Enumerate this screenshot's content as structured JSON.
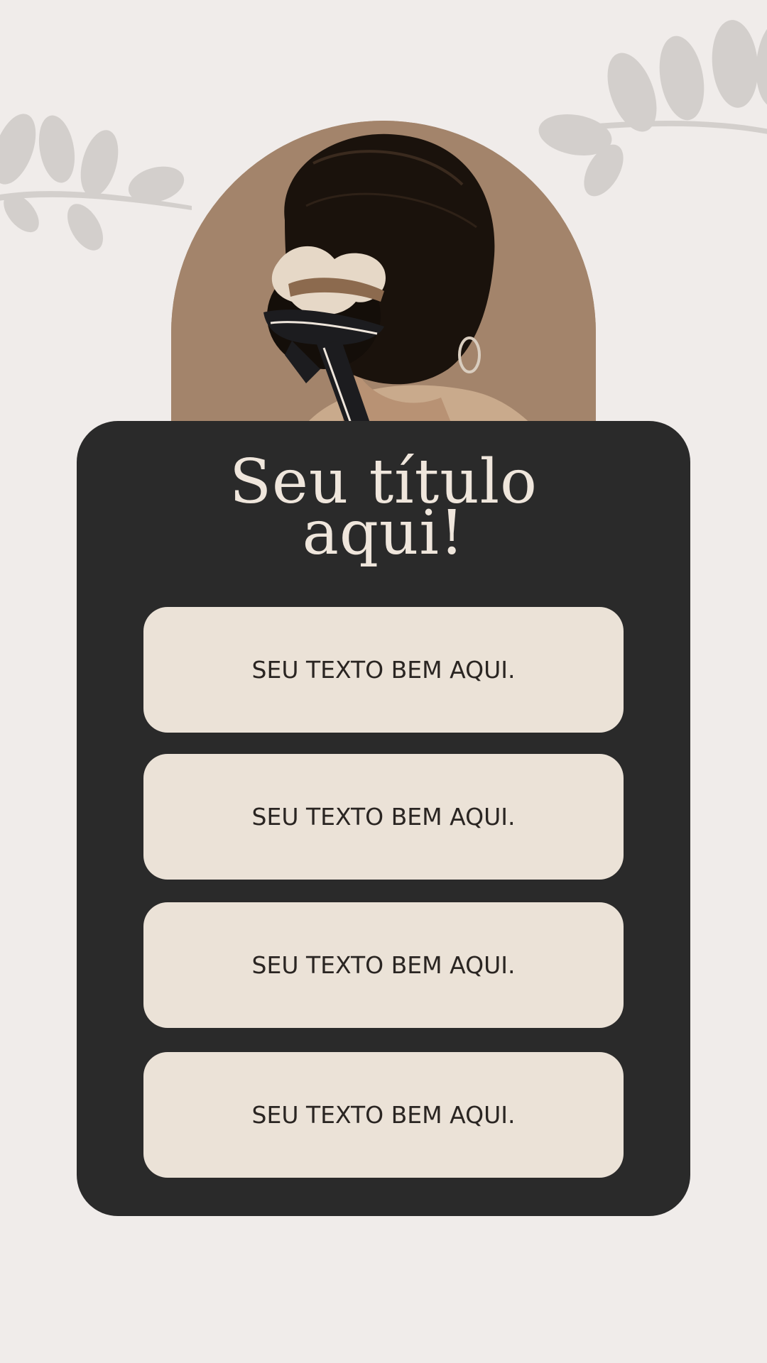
{
  "title": {
    "line1": "Seu título",
    "line2": "aqui!"
  },
  "text_boxes": [
    {
      "label": "SEU TEXTO BEM AQUI."
    },
    {
      "label": "SEU TEXTO BEM AQUI."
    },
    {
      "label": "SEU TEXTO BEM AQUI."
    },
    {
      "label": "SEU TEXTO BEM AQUI."
    }
  ],
  "colors": {
    "background": "#f0ecea",
    "card": "#2a2a2a",
    "box": "#ebe2d7",
    "title_text": "#efe6dc",
    "box_text": "#2a2522",
    "photo_background": "#a3846b",
    "leaves": "#d3cfcc"
  },
  "icons": {
    "decor_left": "leaf-branch-icon",
    "decor_right": "leaf-branch-icon"
  }
}
